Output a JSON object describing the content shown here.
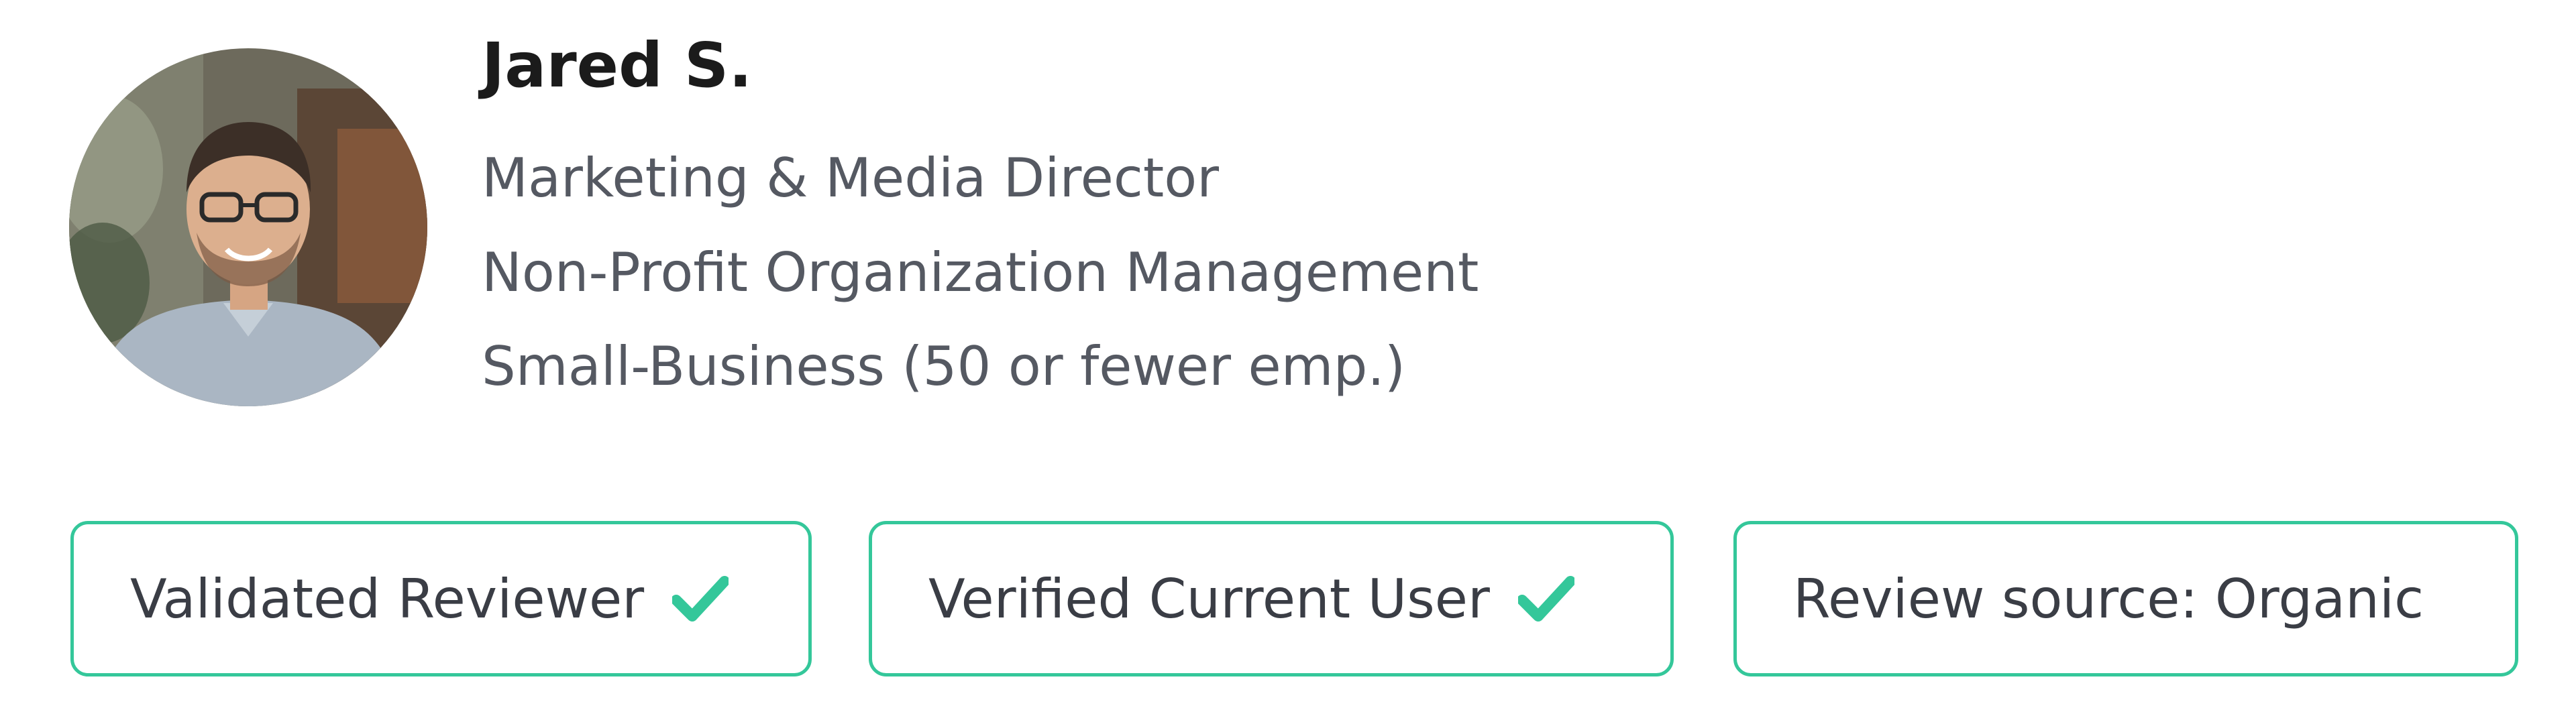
{
  "reviewer": {
    "name": "Jared S.",
    "title": "Marketing & Media Director",
    "industry": "Non-Profit Organization Management",
    "company_size": "Small-Business (50 or fewer emp.)",
    "avatar_icon": "reviewer-photo"
  },
  "badges": [
    {
      "label": "Validated Reviewer",
      "icon": "checkmark-icon",
      "checked": true
    },
    {
      "label": "Verified Current User",
      "icon": "checkmark-icon",
      "checked": true
    },
    {
      "label": "Review source: Organic",
      "checked": false
    }
  ],
  "colors": {
    "accent": "#34c79a",
    "name_text": "#1b1b1b",
    "detail_text": "#555962"
  }
}
